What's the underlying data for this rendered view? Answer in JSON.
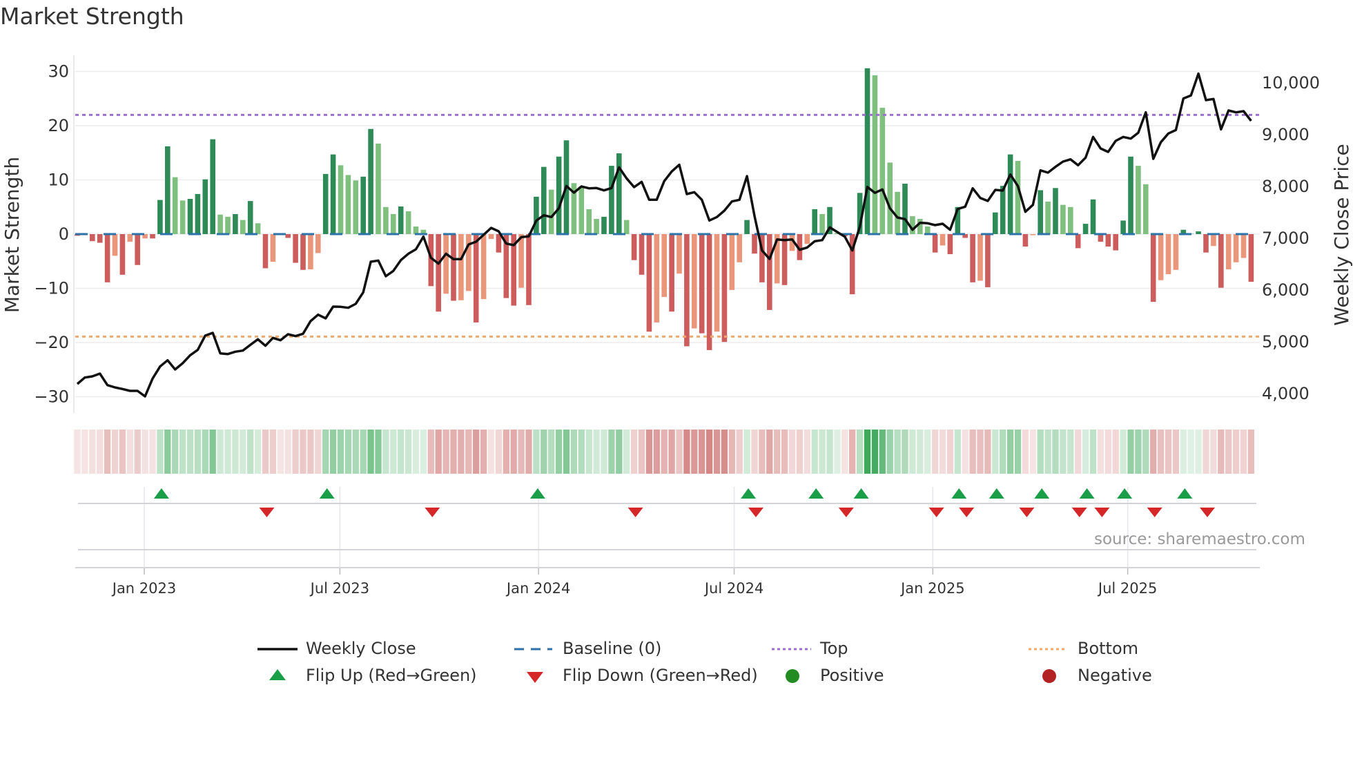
{
  "chart_data": {
    "type": "bar",
    "title": "Market Strength",
    "ylabel": "Market Strength",
    "y2label": "Weekly Close Price",
    "ylim": [
      -33,
      33
    ],
    "y2lim": [
      3627,
      10533
    ],
    "yticks": [
      30,
      20,
      10,
      0,
      -10,
      -20,
      -30
    ],
    "ytick_labels": [
      "30",
      "20",
      "10",
      "0",
      "−10",
      "−20",
      "−30"
    ],
    "y2ticks": [
      10000,
      9000,
      8000,
      7000,
      6000,
      5000,
      4000
    ],
    "y2tick_labels": [
      "10,000",
      "9,000",
      "8,000",
      "7,000",
      "6,000",
      "5,000",
      "4,000"
    ],
    "xticks": [
      {
        "label": "Jan 2023",
        "week_index": 8.9
      },
      {
        "label": "Jul 2023",
        "week_index": 34.9
      },
      {
        "label": "Jan 2024",
        "week_index": 61.3
      },
      {
        "label": "Jul 2024",
        "week_index": 87.3
      },
      {
        "label": "Jan 2025",
        "week_index": 113.7
      },
      {
        "label": "Jul 2025",
        "week_index": 139.6
      }
    ],
    "grid": true,
    "top_level": 22,
    "bottom_level": -18.9,
    "baseline": 0,
    "strength": [
      -0.3,
      -0.2,
      -1.3,
      -1.6,
      -8.9,
      -4.0,
      -7.5,
      -1.4,
      -5.7,
      -0.8,
      -0.8,
      6.3,
      16.2,
      10.5,
      6.2,
      6.5,
      7.4,
      10.1,
      17.5,
      3.6,
      3.2,
      3.7,
      2.6,
      6.1,
      2.0,
      -6.3,
      -5.1,
      -0.2,
      -0.7,
      -5.3,
      -6.6,
      -6.5,
      -3.5,
      11.1,
      14.7,
      12.7,
      10.9,
      9.9,
      10.6,
      19.4,
      16.7,
      5.0,
      3.7,
      5.1,
      4.2,
      1.4,
      0.8,
      -9.6,
      -14.3,
      -11,
      -12.3,
      -12.2,
      -10.5,
      -16.3,
      -12,
      -0.9,
      -3.4,
      -11.8,
      -13.2,
      -9.9,
      -13.1,
      6.9,
      12.4,
      8.2,
      14.3,
      17.3,
      9.4,
      8.8,
      4.6,
      2.8,
      3.2,
      12.6,
      14.9,
      2.6,
      -4.8,
      -7.5,
      -18,
      -16.3,
      -11.6,
      -14.3,
      -7.3,
      -20.7,
      -17.4,
      -18.3,
      -21.4,
      -18,
      -19.9,
      -10.3,
      -5.2,
      2.6,
      -3.6,
      -8.9,
      -14,
      -9.1,
      -9.4,
      -3.1,
      -4.8,
      -1.8,
      4.6,
      3.7,
      5.0,
      0.2,
      -0.4,
      -11.1,
      7.6,
      30.6,
      29.3,
      23.3,
      13.2,
      7.8,
      9.3,
      3.3,
      2.8,
      1.4,
      -3.4,
      -2.1,
      -3.7,
      5.0,
      -0.7,
      -8.9,
      -8.6,
      -9.8,
      4.0,
      8.9,
      14.7,
      13.5,
      -2.3,
      -0.2,
      8.1,
      6.0,
      8.5,
      5.4,
      5.0,
      -2.6,
      1.9,
      6.4,
      -1.4,
      -2.3,
      -3.0,
      2.5,
      14.3,
      12.6,
      9.2,
      -12.5,
      -8.5,
      -7.4,
      -6.6,
      0.8,
      0.1,
      0.5,
      -3.4,
      -2.2,
      -9.9,
      -6.5,
      -5.2,
      -4.4,
      -8.8
    ],
    "weekly_close": [
      4187,
      4311,
      4333,
      4387,
      4164,
      4120,
      4089,
      4053,
      4053,
      3947,
      4289,
      4524,
      4644,
      4467,
      4587,
      4742,
      4844,
      5120,
      5173,
      4778,
      4764,
      4809,
      4831,
      4942,
      5049,
      4924,
      5076,
      5031,
      5147,
      5111,
      5156,
      5400,
      5524,
      5453,
      5680,
      5676,
      5658,
      5733,
      5956,
      6547,
      6569,
      6267,
      6369,
      6578,
      6702,
      6787,
      7031,
      6622,
      6511,
      6702,
      6596,
      6596,
      6880,
      6933,
      7067,
      7200,
      7133,
      6898,
      6867,
      7022,
      7036,
      7340,
      7444,
      7409,
      7578,
      8009,
      7880,
      8000,
      7964,
      7969,
      7924,
      7969,
      8369,
      8156,
      7987,
      8089,
      7742,
      7742,
      8102,
      8289,
      8418,
      7853,
      7889,
      7742,
      7342,
      7409,
      7533,
      7711,
      7742,
      8200,
      7431,
      6764,
      6600,
      6978,
      6964,
      6978,
      6778,
      6822,
      6942,
      6964,
      7209,
      7120,
      7031,
      6764,
      7222,
      7991,
      7876,
      7942,
      7578,
      7400,
      7369,
      7164,
      7298,
      7289,
      7253,
      7280,
      7164,
      7564,
      7609,
      7964,
      7778,
      7720,
      7933,
      7920,
      8231,
      8009,
      7511,
      7644,
      8311,
      8267,
      8378,
      8480,
      8524,
      8409,
      8556,
      8956,
      8733,
      8667,
      8880,
      8956,
      8924,
      9036,
      9431,
      8533,
      8853,
      9022,
      9089,
      9698,
      9756,
      10178,
      9667,
      9689,
      9102,
      9467,
      9431,
      9453,
      9267
    ],
    "flip_up_weeks": [
      11,
      33,
      61,
      89,
      98,
      104,
      117,
      122,
      128,
      134,
      139,
      147
    ],
    "flip_down_weeks": [
      25,
      47,
      74,
      90,
      102,
      114,
      118,
      126,
      133,
      136,
      143,
      150
    ],
    "legend": {
      "position": "bottom",
      "items": [
        "Weekly Close",
        "Baseline (0)",
        "Top",
        "Bottom",
        "Flip Up (Red→Green)",
        "Flip Down (Green→Red)",
        "Positive",
        "Negative"
      ]
    },
    "annotation": "source: sharemaestro.com"
  },
  "colors": {
    "strong_pos": "#2e8b57",
    "weak_pos": "#80c07f",
    "strong_neg": "#cd5c5c",
    "weak_neg": "#e9967a",
    "line": "#111111",
    "baseline": "#2b73a8",
    "top": "#9a6fd0",
    "bottom": "#f0a870",
    "flip_up": "#1a9e48",
    "flip_down": "#d62728",
    "positive": "#228b22",
    "negative": "#b22222",
    "heat_pos": "#2ca04c",
    "heat_neg": "#c0504d"
  }
}
